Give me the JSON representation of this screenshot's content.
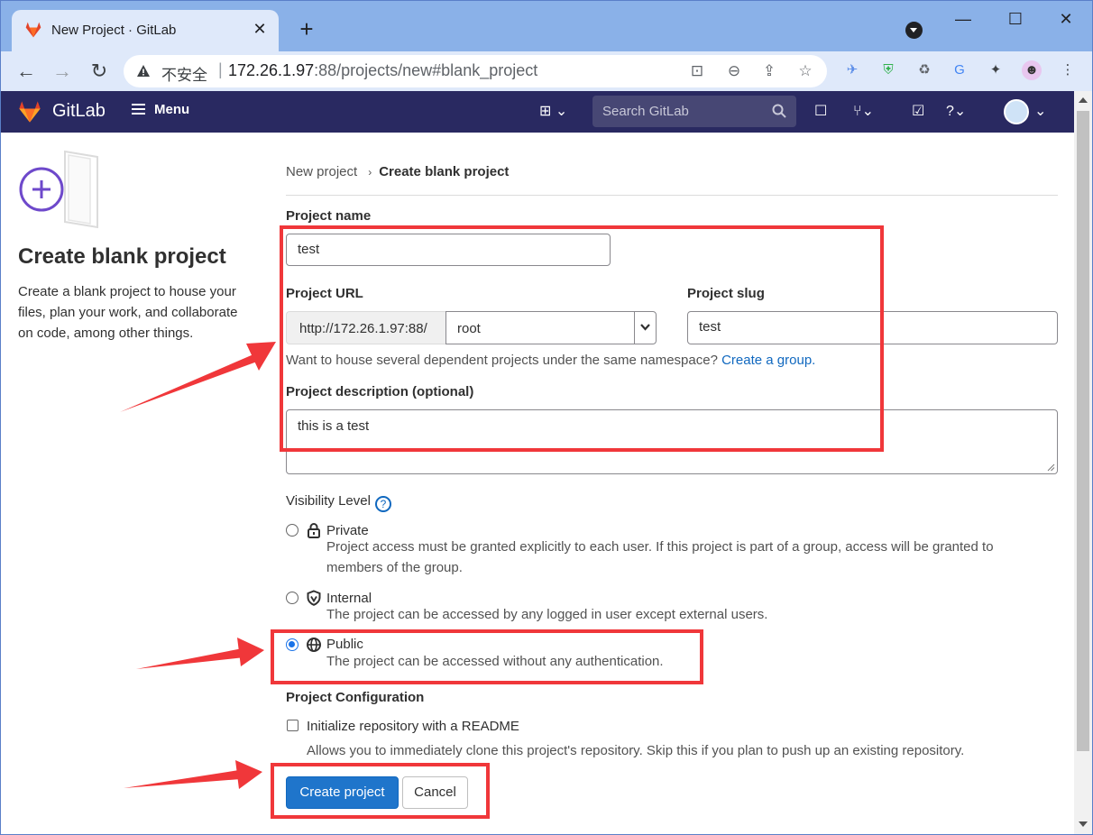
{
  "browser": {
    "tab_title": "New Project · GitLab",
    "insecure_label": "不安全",
    "url_host": "172.26.1.97",
    "url_rest": ":88/projects/new#blank_project",
    "accent_color": "#8ab1e8"
  },
  "gitlab_nav": {
    "brand": "GitLab",
    "menu_label": "Menu",
    "search_placeholder": "Search GitLab",
    "nav_color": "#292961"
  },
  "left_panel": {
    "title": "Create blank project",
    "description": "Create a blank project to house your files, plan your work, and collaborate on code, among other things."
  },
  "breadcrumb": {
    "parent": "New project",
    "current": "Create blank project"
  },
  "form": {
    "project_name_label": "Project name",
    "project_name_value": "test",
    "project_url_label": "Project URL",
    "url_prefix": "http://172.26.1.97:88/",
    "namespace_value": "root",
    "project_slug_label": "Project slug",
    "project_slug_value": "test",
    "namespace_help": "Want to house several dependent projects under the same namespace?",
    "create_group_link": "Create a group.",
    "description_label": "Project description (optional)",
    "description_value": "this is a test",
    "visibility_label": "Visibility Level",
    "visibility_options": [
      {
        "title": "Private",
        "description": "Project access must be granted explicitly to each user. If this project is part of a group, access will be granted to members of the group.",
        "selected": false
      },
      {
        "title": "Internal",
        "description": "The project can be accessed by any logged in user except external users.",
        "selected": false
      },
      {
        "title": "Public",
        "description": "The project can be accessed without any authentication.",
        "selected": true
      }
    ],
    "config_label": "Project Configuration",
    "readme_label": "Initialize repository with a README",
    "readme_help": "Allows you to immediately clone this project's repository. Skip this if you plan to push up an existing repository.",
    "readme_checked": false,
    "create_button": "Create project",
    "cancel_button": "Cancel",
    "primary_color": "#1f75cb"
  },
  "annotation_color": "#f0373a"
}
